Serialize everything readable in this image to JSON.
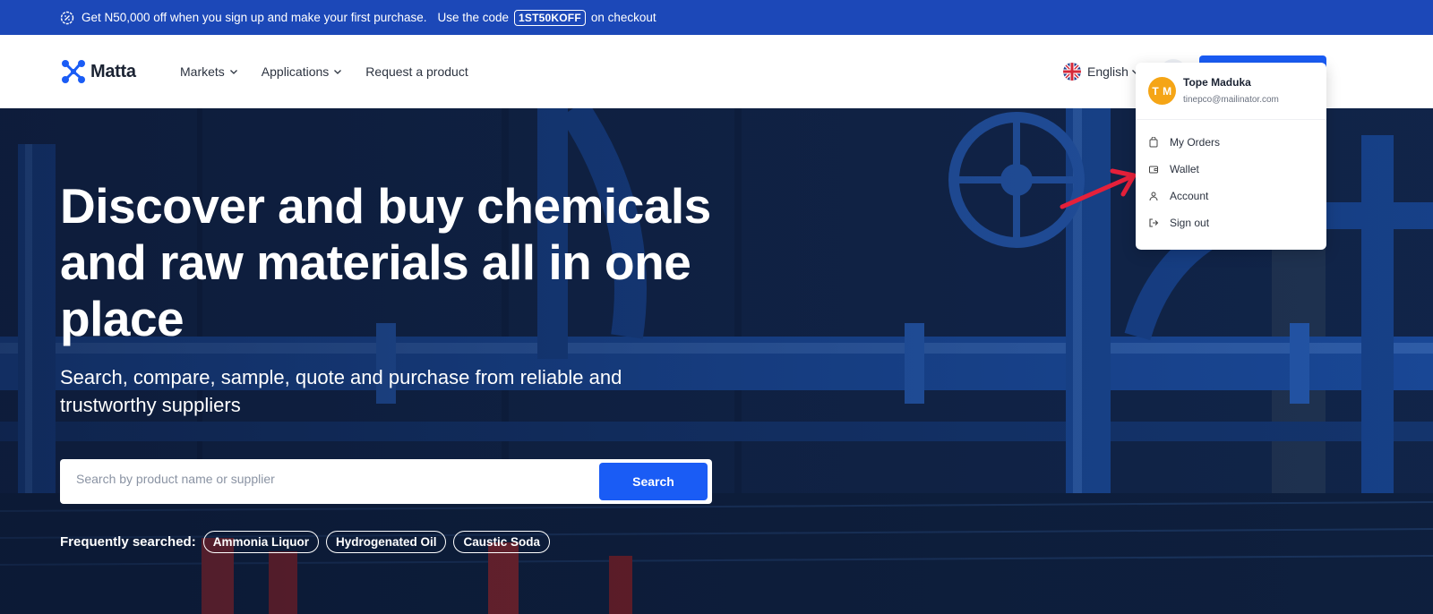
{
  "promo": {
    "text_before": "Get N50,000 off when you sign up and make your first purchase.",
    "text_use": "Use the code",
    "code": "1ST50KOFF",
    "text_after": "on checkout",
    "icon": "discount-badge-icon"
  },
  "nav": {
    "brand": "Matta",
    "menu": [
      {
        "label": "Markets",
        "has_dropdown": true
      },
      {
        "label": "Applications",
        "has_dropdown": true
      },
      {
        "label": "Request a product",
        "has_dropdown": false
      }
    ],
    "language": "English",
    "language_flag": "uk-flag-icon"
  },
  "hero": {
    "headline": "Discover and buy chemicals and raw materials all in one place",
    "subheadline": "Search, compare, sample, quote and purchase from reliable and trustworthy suppliers",
    "search": {
      "placeholder": "Search by product name or supplier",
      "value": "",
      "button_label": "Search"
    },
    "frequently_searched": {
      "label": "Frequently searched:",
      "chips": [
        "Ammonia Liquor",
        "Hydrogenated Oil",
        "Caustic Soda"
      ]
    }
  },
  "user_menu": {
    "initials": "T M",
    "name": "Tope Maduka",
    "email": "tinepco@mailinator.com",
    "items": [
      {
        "label": "My Orders",
        "icon": "shopping-bag-icon"
      },
      {
        "label": "Wallet",
        "icon": "wallet-icon"
      },
      {
        "label": "Account",
        "icon": "user-icon"
      },
      {
        "label": "Sign out",
        "icon": "sign-out-icon"
      }
    ]
  },
  "colors": {
    "promo_bg": "#1c48b8",
    "primary": "#1a5cf5",
    "avatar": "#f5a516",
    "annotation_arrow": "#e5203a"
  }
}
